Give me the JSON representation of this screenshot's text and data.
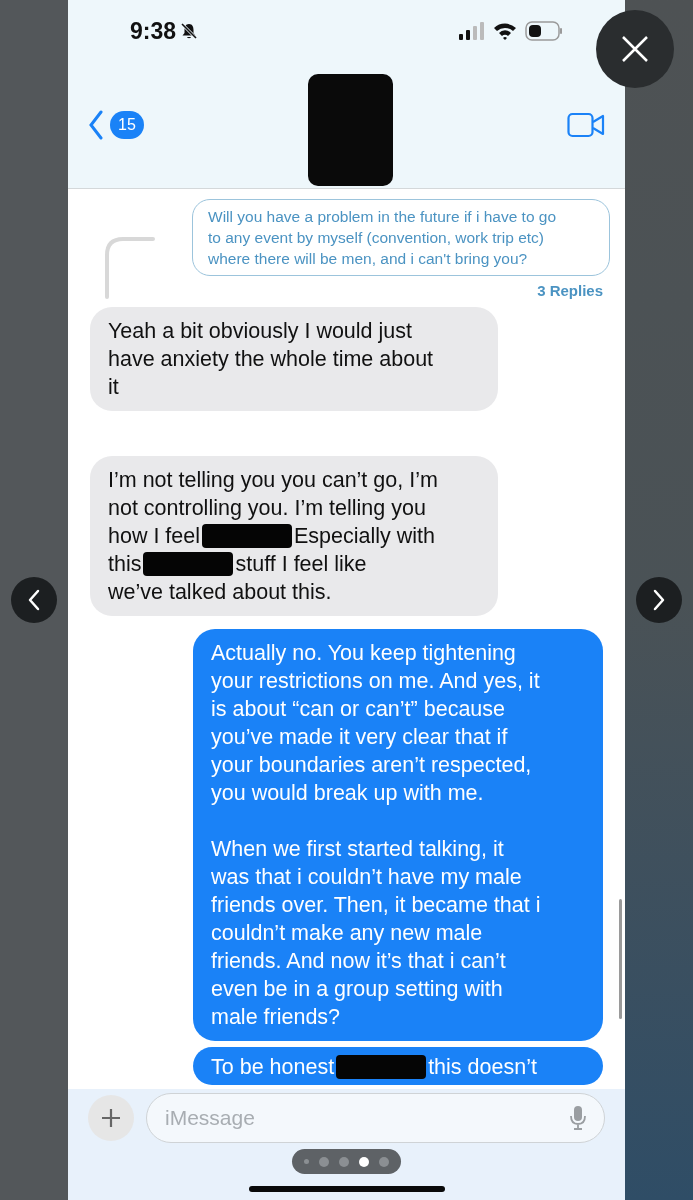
{
  "status_bar": {
    "time": "9:38",
    "silenced": true
  },
  "header": {
    "back_count": "15"
  },
  "thread": {
    "quoted": [
      "Will you have a problem in the future if i have to go",
      "to any event by myself (convention, work trip etc)",
      "where there will be men, and i can't bring you?"
    ],
    "replies": "3 Replies"
  },
  "messages": [
    {
      "kind": "received",
      "paragraphs": [
        [
          [
            "Yeah a bit obviously I would just"
          ],
          [
            "have anxiety the whole time about"
          ],
          [
            "it"
          ]
        ]
      ]
    },
    {
      "kind": "received",
      "paragraphs": [
        [
          [
            "I’m not telling you you can’t go, I’m"
          ],
          [
            "not controlling you. I’m telling you"
          ],
          [
            "how I feel",
            {
              "kind": "redaction"
            },
            "Especially with"
          ],
          [
            "this",
            {
              "kind": "redaction"
            },
            "stuff I feel like"
          ],
          [
            "we’ve talked about this."
          ]
        ]
      ]
    },
    {
      "kind": "sent",
      "paragraphs": [
        [
          [
            "Actually no. You keep tightening"
          ],
          [
            "your restrictions on me. And yes, it"
          ],
          [
            "is about “can or can’t” because"
          ],
          [
            "you’ve made it very clear that if"
          ],
          [
            "your boundaries aren’t respected,"
          ],
          [
            "you would break up with me."
          ]
        ],
        [
          [
            "When we first started talking, it"
          ],
          [
            "was that i couldn’t have my male"
          ],
          [
            "friends over. Then, it became that i"
          ],
          [
            "couldn’t make any new male"
          ],
          [
            "friends. And now it’s that i can’t"
          ],
          [
            "even be in a group setting with"
          ],
          [
            "male friends?"
          ]
        ]
      ]
    },
    {
      "kind": "sent",
      "paragraphs": [
        [
          [
            "To be honest",
            {
              "kind": "redaction"
            },
            "this doesn’t"
          ]
        ]
      ]
    }
  ],
  "composer": {
    "placeholder": "iMessage"
  },
  "pages": [
    {
      "selected": false
    },
    {
      "selected": false
    },
    {
      "selected": false
    },
    {
      "selected": true
    },
    {
      "selected": false
    }
  ]
}
